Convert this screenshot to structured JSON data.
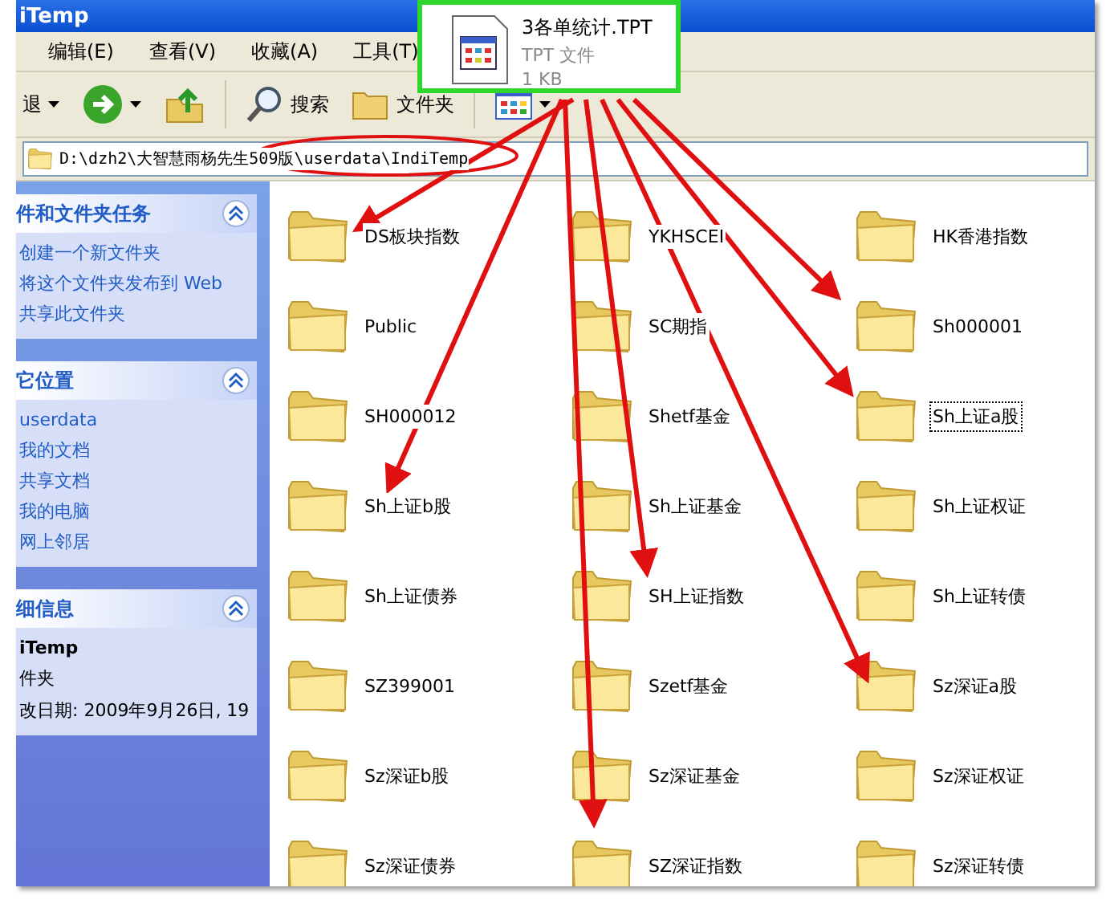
{
  "window": {
    "title": "iTemp"
  },
  "menu": [
    {
      "label": "编辑(E)"
    },
    {
      "label": "查看(V)"
    },
    {
      "label": "收藏(A)"
    },
    {
      "label": "工具(T)"
    }
  ],
  "toolbar": [
    {
      "kind": "back",
      "label": "退"
    },
    {
      "kind": "forward"
    },
    {
      "kind": "up"
    },
    {
      "kind": "search",
      "label": "搜索"
    },
    {
      "kind": "folders",
      "label": "文件夹"
    },
    {
      "kind": "views"
    }
  ],
  "address": {
    "path": "D:\\dzh2\\大智慧雨杨先生509版\\userdata\\IndiTemp"
  },
  "sidebar": [
    {
      "title": "件和文件夹任务",
      "expanded": true,
      "items": [
        {
          "label": "创建一个新文件夹"
        },
        {
          "label": "将这个文件夹发布到 Web"
        },
        {
          "label": "共享此文件夹"
        }
      ]
    },
    {
      "title": "它位置",
      "expanded": true,
      "items": [
        {
          "label": "userdata"
        },
        {
          "label": "我的文档"
        },
        {
          "label": "共享文档"
        },
        {
          "label": "我的电脑"
        },
        {
          "label": "网上邻居"
        }
      ]
    },
    {
      "title": "细信息",
      "expanded": true,
      "details": [
        {
          "kind": "name",
          "text": "iTemp"
        },
        {
          "kind": "text",
          "text": "件夹"
        },
        {
          "kind": "text",
          "text": "改日期: 2009年9月26日, 19"
        }
      ]
    }
  ],
  "folders": [
    {
      "name": "DS板块指数",
      "selected": false
    },
    {
      "name": "YKHSCEI",
      "selected": false
    },
    {
      "name": "HK香港指数",
      "selected": false
    },
    {
      "name": "Public",
      "selected": false
    },
    {
      "name": "SC期指",
      "selected": false
    },
    {
      "name": "Sh000001",
      "selected": false
    },
    {
      "name": "SH000012",
      "selected": false
    },
    {
      "name": "Shetf基金",
      "selected": false
    },
    {
      "name": "Sh上证a股",
      "selected": true
    },
    {
      "name": "Sh上证b股",
      "selected": false
    },
    {
      "name": "Sh上证基金",
      "selected": false
    },
    {
      "name": "Sh上证权证",
      "selected": false
    },
    {
      "name": "Sh上证债券",
      "selected": false
    },
    {
      "name": "SH上证指数",
      "selected": false
    },
    {
      "name": "Sh上证转债",
      "selected": false
    },
    {
      "name": "SZ399001",
      "selected": false
    },
    {
      "name": "Szetf基金",
      "selected": false
    },
    {
      "name": "Sz深证a股",
      "selected": false
    },
    {
      "name": "Sz深证b股",
      "selected": false
    },
    {
      "name": "Sz深证基金",
      "selected": false
    },
    {
      "name": "Sz深证权证",
      "selected": false
    },
    {
      "name": "Sz深证债券",
      "selected": false
    },
    {
      "name": "SZ深证指数",
      "selected": false
    },
    {
      "name": "Sz深证转债",
      "selected": false
    }
  ],
  "tooltip": {
    "name": "3各单统计.TPT",
    "type": "TPT 文件",
    "size": "1 KB"
  }
}
